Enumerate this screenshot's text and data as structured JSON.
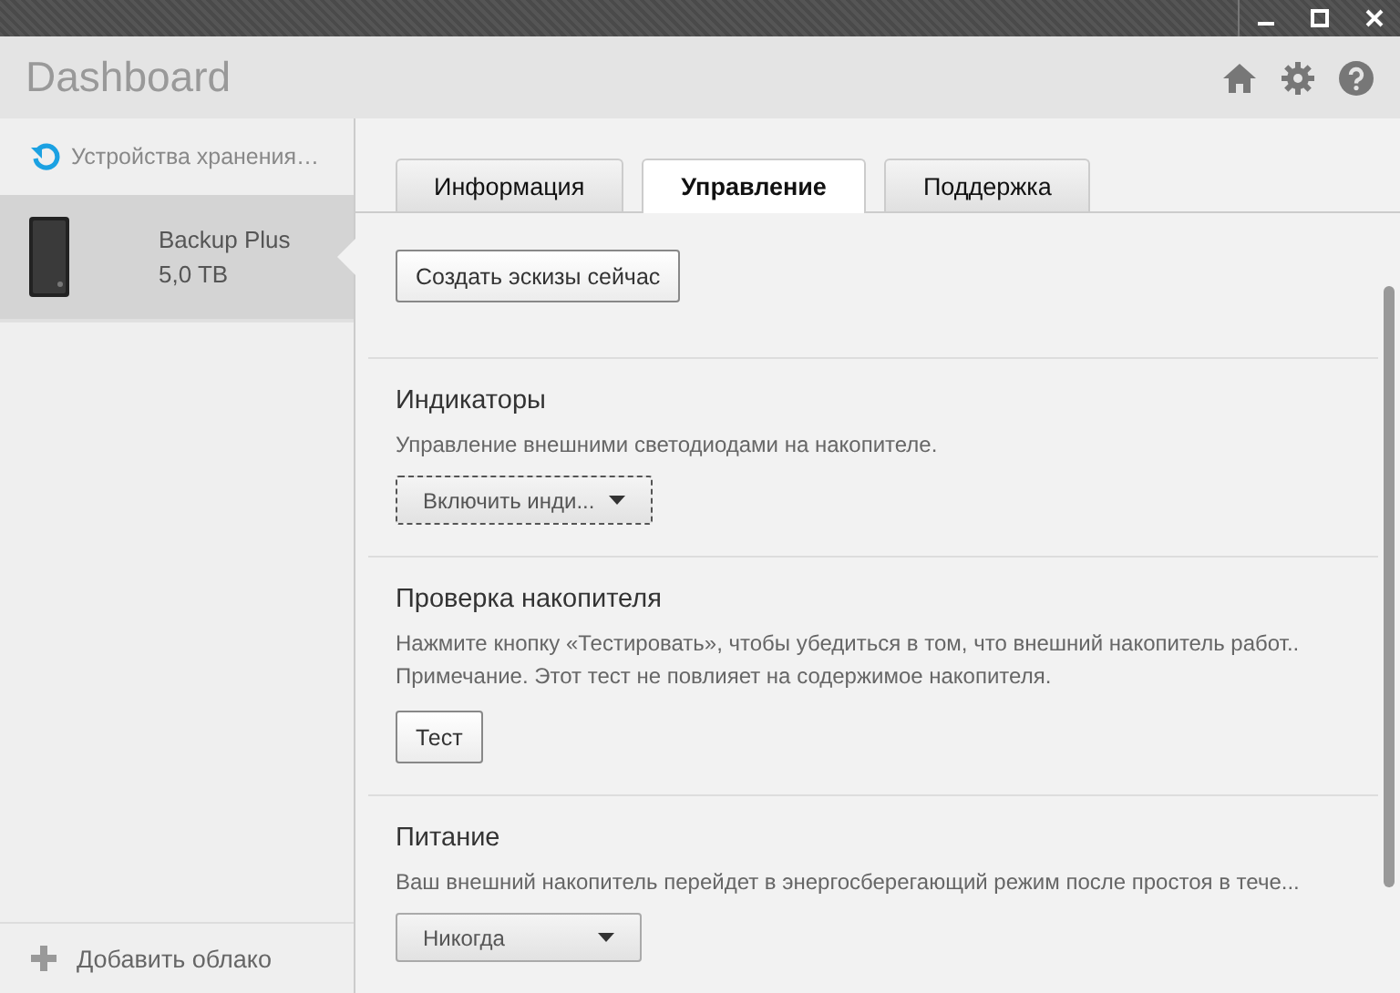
{
  "window": {
    "title": "Dashboard"
  },
  "sidebar": {
    "header": "Устройства хранения…",
    "devices": [
      {
        "name": "Backup Plus",
        "capacity": "5,0 TB",
        "selected": true
      }
    ],
    "footer": "Добавить облако"
  },
  "tabs": [
    {
      "label": "Информация",
      "selected": false
    },
    {
      "label": "Управление",
      "selected": true
    },
    {
      "label": "Поддержка",
      "selected": false
    }
  ],
  "sections": [
    {
      "control": {
        "kind": "button",
        "label": "Создать эскизы сейчас",
        "focused": false
      }
    },
    {
      "title": "Индикаторы",
      "lines": [
        "Управление внешними светодиодами на накопителе."
      ],
      "control": {
        "kind": "dropdown",
        "label": "Включить инди...",
        "focused": true
      }
    },
    {
      "title": "Проверка накопителя",
      "lines": [
        "Нажмите кнопку «Тестировать», чтобы убедиться в том, что внешний накопитель работ..",
        "Примечание. Этот тест не повлияет на содержимое накопителя."
      ],
      "control": {
        "kind": "button",
        "label": "Тест",
        "focused": false
      }
    },
    {
      "title": "Питание",
      "lines": [
        "Ваш внешний накопитель перейдет в энергосберегающий режим после простоя в тече..."
      ],
      "control": {
        "kind": "dropdown",
        "label": "Никогда",
        "focused": false
      }
    }
  ]
}
